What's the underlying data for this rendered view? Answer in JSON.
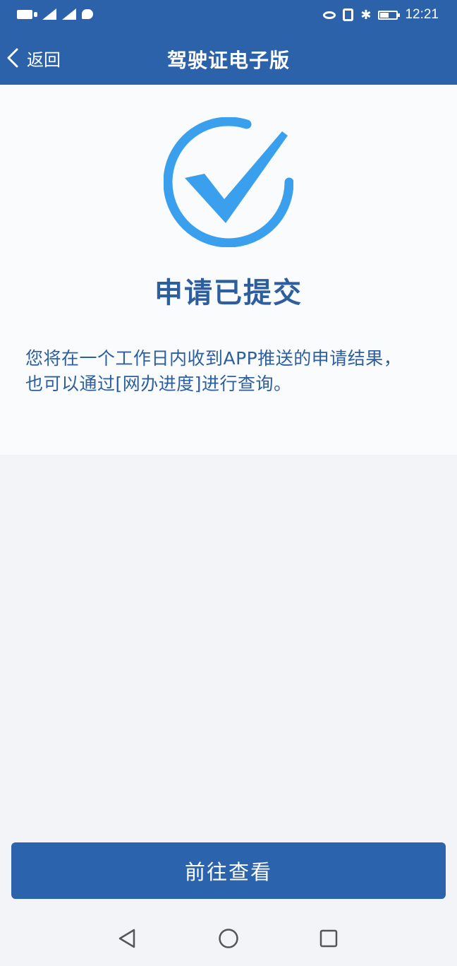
{
  "status_bar": {
    "time": "12:21",
    "left_icons": [
      "sim-card-icon",
      "signal-icon",
      "signal-icon",
      "chat-icon"
    ],
    "right_icons": [
      "eye-icon",
      "nfc-icon",
      "bluetooth-icon",
      "battery-icon"
    ]
  },
  "nav": {
    "back_label": "返回",
    "title": "驾驶证电子版",
    "back_icon": "chevron-left-icon"
  },
  "result": {
    "icon": "check-circle-icon",
    "title": "申请已提交",
    "description": "您将在一个工作日内收到APP推送的申请结果，也可以通过[网办进度]进行查询。"
  },
  "action": {
    "button_label": "前往查看"
  },
  "system_nav": {
    "icons": [
      "back-triangle-icon",
      "home-circle-icon",
      "recents-square-icon"
    ]
  },
  "colors": {
    "header": "#2c62a9",
    "accent": "#3aa0ee",
    "title_text": "#2d5e9e",
    "button": "#2b63ad",
    "background": "#f2f4f7"
  }
}
